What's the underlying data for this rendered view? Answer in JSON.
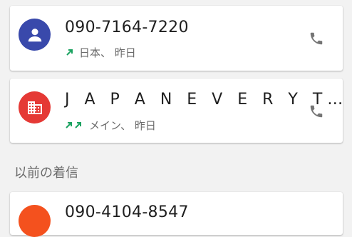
{
  "calls": [
    {
      "number": "090-7164-7220",
      "detail": "日本、 昨日",
      "avatar_color": "#3949ab",
      "avatar_icon": "person-icon",
      "call_type": "outgoing-icon"
    },
    {
      "number": "J A P A N E V E R Y T…",
      "detail": "メイン、 昨日",
      "avatar_color": "#e53935",
      "avatar_icon": "business-icon",
      "call_type": "outgoing-double-icon"
    },
    {
      "number": "090-4104-8547",
      "avatar_color": "#f4511e"
    }
  ],
  "section": {
    "earlier_label": "以前の着信"
  },
  "colors": {
    "background": "#f2f2f2",
    "call_arrow": "#1aa260",
    "icon_grey": "#757575"
  }
}
